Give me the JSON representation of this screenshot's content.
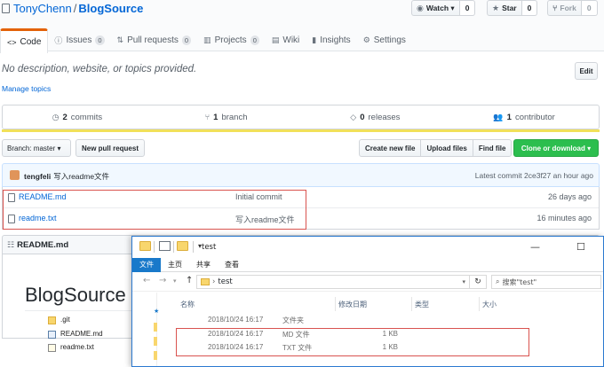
{
  "repo": {
    "owner": "TonyChenn",
    "separator": "/",
    "name": "BlogSource"
  },
  "social": {
    "watch": {
      "label": "Watch ▾",
      "count": "0"
    },
    "star": {
      "label": "Star",
      "count": "0"
    },
    "fork": {
      "label": "Fork",
      "count": "0"
    }
  },
  "tabs": [
    {
      "label": "Code",
      "count": ""
    },
    {
      "label": "Issues",
      "count": "0"
    },
    {
      "label": "Pull requests",
      "count": "0"
    },
    {
      "label": "Projects",
      "count": "0"
    },
    {
      "label": "Wiki",
      "count": ""
    },
    {
      "label": "Insights",
      "count": ""
    },
    {
      "label": "Settings",
      "count": ""
    }
  ],
  "about": {
    "description": "No description, website, or topics provided.",
    "edit_label": "Edit",
    "manage_topics": "Manage topics"
  },
  "summary": {
    "commits": "2",
    "commits_label": "commits",
    "branches": "1",
    "branches_label": "branch",
    "releases": "0",
    "releases_label": "releases",
    "contributors": "1",
    "contributors_label": "contributor"
  },
  "toolbar": {
    "branch_label": "Branch: master ▾",
    "new_pr": "New pull request",
    "create_file": "Create new file",
    "upload_files": "Upload files",
    "find_file": "Find file",
    "clone": "Clone or download ▾"
  },
  "latest_commit": {
    "author": "tengfeli",
    "message": "写入readme文件",
    "info": "Latest commit 2ce3f27 an hour ago"
  },
  "files": [
    {
      "name": "README.md",
      "message": "Initial commit",
      "age": "26 days ago"
    },
    {
      "name": "readme.txt",
      "message": "写入readme文件",
      "age": "16 minutes ago"
    }
  ],
  "readme": {
    "header": "README.md",
    "title": "BlogSource"
  },
  "explorer": {
    "title": "test",
    "window_controls": {
      "minimize": "—",
      "maximize": "☐"
    },
    "ribbon": [
      "文件",
      "主页",
      "共享",
      "查看"
    ],
    "address": "test",
    "search_placeholder": "搜索\"test\"",
    "columns": {
      "name": "名称",
      "date": "修改日期",
      "type": "类型",
      "size": "大小"
    },
    "rows": [
      {
        "name": ".git",
        "date": "2018/10/24 16:17",
        "type": "文件夹",
        "size": ""
      },
      {
        "name": "README.md",
        "date": "2018/10/24 16:17",
        "type": "MD 文件",
        "size": "1 KB"
      },
      {
        "name": "readme.txt",
        "date": "2018/10/24 16:17",
        "type": "TXT 文件",
        "size": "1 KB"
      }
    ]
  },
  "colors": {
    "accent_link": "#0366d6",
    "tab_active": "#e36209",
    "clone_green": "#2cbe4e",
    "language_bar": "#f1e05a",
    "highlight_box": "#d9534f",
    "explorer_blue": "#1979ca"
  }
}
